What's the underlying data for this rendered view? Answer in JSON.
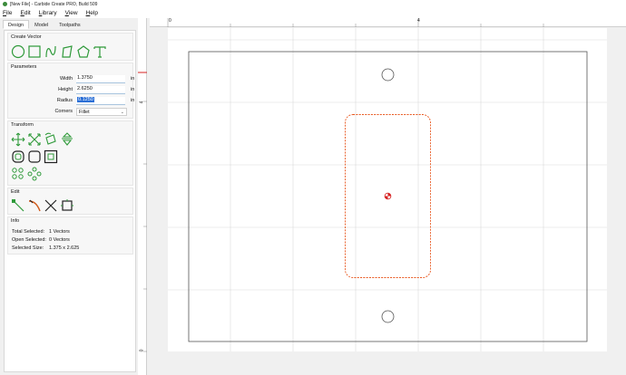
{
  "window": {
    "title": "[New File] - Carbide Create PRO, Build 509"
  },
  "menu": [
    "File",
    "Edit",
    "Library",
    "View",
    "Help"
  ],
  "tabs": [
    "Design",
    "Model",
    "Toolpaths"
  ],
  "create_vector": {
    "title": "Create Vector",
    "tools": [
      "circle-icon",
      "rectangle-icon",
      "curve-icon",
      "polygon-icon",
      "pentagon-icon",
      "text-icon"
    ]
  },
  "parameters": {
    "title": "Parameters",
    "width_label": "Width",
    "width_value": "1.3750",
    "height_label": "Height",
    "height_value": "2.6250",
    "radius_label": "Radius",
    "radius_value": "0.1250",
    "unit": "in",
    "corners_label": "Corners",
    "corners_value": "Fillet"
  },
  "transform": {
    "title": "Transform",
    "tools": [
      "move-icon",
      "scale-icon",
      "rotate-icon",
      "mirror-icon",
      "offset-icon",
      "fillet-icon",
      "align-icon",
      "array-icon",
      "circular-array-icon"
    ]
  },
  "edit": {
    "title": "Edit",
    "tools": [
      "node-edit-icon",
      "trim-icon",
      "cut-icon",
      "boolean-icon"
    ]
  },
  "info": {
    "title": "Info",
    "total_selected_label": "Total Selected:",
    "total_selected_value": "1 Vectors",
    "open_selected_label": "Open Selected:",
    "open_selected_value": "0 Vectors",
    "selected_size_label": "Selected Size:",
    "selected_size_value": "1.375 x 2.625"
  },
  "rulers": {
    "top_labels": [
      "0",
      "4"
    ],
    "left_labels": [
      "4",
      "0"
    ]
  },
  "colors": {
    "selection": "#e8571e",
    "grid": "#d9d9d9",
    "stock_border": "#555555",
    "origin_marker": "#d62020",
    "highlight": "#2b6fd6"
  }
}
